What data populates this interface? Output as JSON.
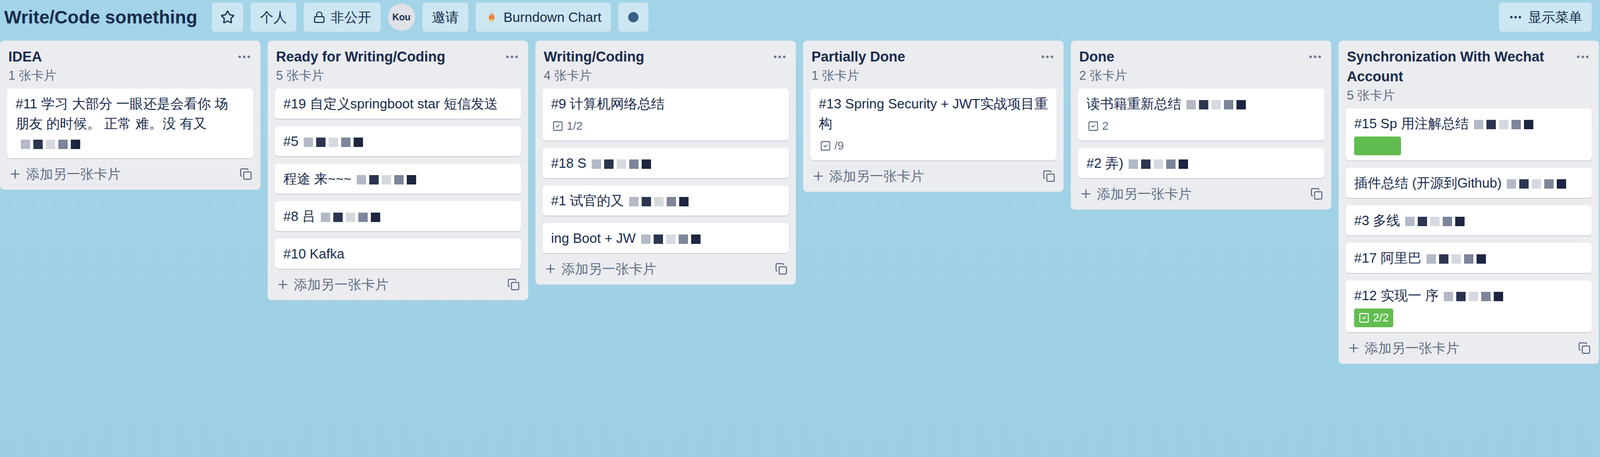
{
  "board": {
    "title": "Write/Code something",
    "starred": false,
    "chips": [
      {
        "label": "个人",
        "kind": "text"
      },
      {
        "label": "非公开",
        "kind": "lock"
      },
      {
        "label": "Kou",
        "kind": "avatar"
      },
      {
        "label": "邀请",
        "kind": "text"
      },
      {
        "label": "Burndown Chart",
        "kind": "powerup"
      }
    ]
  },
  "menu": {
    "label": "显示菜单"
  },
  "lists": [
    {
      "title": "IDEA",
      "count": "1 张卡片",
      "add_label": "添加另一张卡片",
      "cards": [
        {
          "text": "#11 学习  大部分  一眼还是会看你  场  朋友  的时候。 正常  难。没  有又",
          "redacted": true,
          "label_color": null,
          "checklist": null
        }
      ]
    },
    {
      "title": "Ready for Writing/Coding",
      "count": "5 张卡片",
      "add_label": "添加另一张卡片",
      "cards": [
        {
          "text": "#19 自定义springboot star 短信发送",
          "redacted": false,
          "label_color": null,
          "checklist": null
        },
        {
          "text": "#5",
          "redacted": true,
          "label_color": null,
          "checklist": null
        },
        {
          "text": "程途  来~~~",
          "redacted": true,
          "label_color": null,
          "checklist": null
        },
        {
          "text": "#8  吕",
          "redacted": true,
          "label_color": null,
          "checklist": null
        },
        {
          "text": "#10 Kafka",
          "redacted": false,
          "label_color": null,
          "checklist": null
        }
      ]
    },
    {
      "title": "Writing/Coding",
      "count": "4 张卡片",
      "add_label": "添加另一张卡片",
      "cards": [
        {
          "text": "#9 计算机网络总结",
          "redacted": false,
          "label_color": null,
          "checklist": {
            "text": "1/2",
            "complete": false
          }
        },
        {
          "text": "#18 S",
          "redacted": true,
          "label_color": null,
          "checklist": null
        },
        {
          "text": "#1  试官的又",
          "redacted": true,
          "label_color": null,
          "checklist": null
        },
        {
          "text": "ing Boot + JW",
          "redacted": true,
          "label_color": null,
          "checklist": null
        }
      ]
    },
    {
      "title": "Partially Done",
      "count": "1 张卡片",
      "add_label": "添加另一张卡片",
      "cards": [
        {
          "text": "#13 Spring Security + JWT实战项目重构",
          "redacted": false,
          "label_color": null,
          "checklist": {
            "text": "/9",
            "complete": false
          }
        }
      ]
    },
    {
      "title": "Done",
      "count": "2 张卡片",
      "add_label": "添加另一张卡片",
      "cards": [
        {
          "text": "读书籍重新总结",
          "redacted": true,
          "label_color": null,
          "checklist": {
            "text": "2",
            "complete": false
          }
        },
        {
          "text": "#2  弄)",
          "redacted": true,
          "label_color": null,
          "checklist": null
        }
      ]
    },
    {
      "title": "Synchronization With Wechat Account",
      "count": "5 张卡片",
      "add_label": "添加另一张卡片",
      "cards": [
        {
          "text": "#15 Sp  用注解总结",
          "redacted": true,
          "label_color": "#61bd4f",
          "checklist": null
        },
        {
          "text": "插件总结  (开源到Github)",
          "redacted": true,
          "label_color": null,
          "checklist": null
        },
        {
          "text": "#3 多线",
          "redacted": true,
          "label_color": null,
          "checklist": null
        },
        {
          "text": "#17 阿里巴",
          "redacted": true,
          "label_color": null,
          "checklist": null
        },
        {
          "text": "#12 实现一  序",
          "redacted": true,
          "label_color": null,
          "checklist": {
            "text": "2/2",
            "complete": true
          }
        }
      ]
    }
  ]
}
